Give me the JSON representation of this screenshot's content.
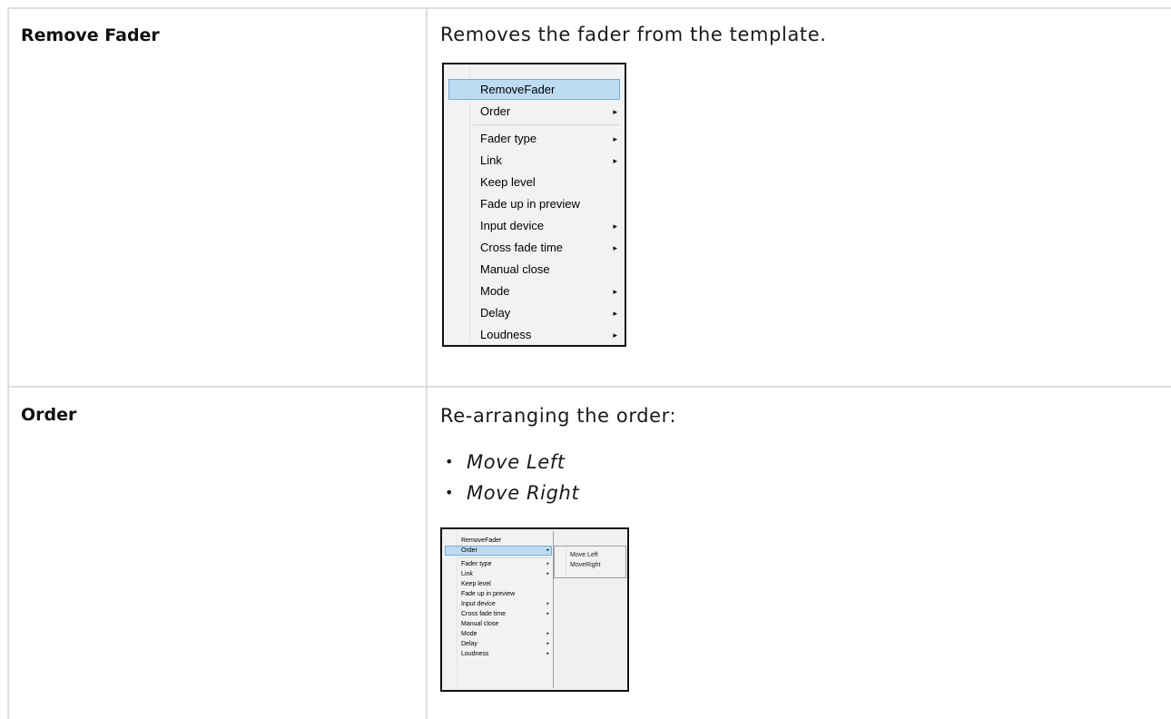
{
  "rows": [
    {
      "term": "Remove Fader",
      "description": "Removes the fader from the template."
    },
    {
      "term": "Order",
      "description": "Re-arranging the order:",
      "bullets": [
        "Move Left",
        "Move Right"
      ]
    }
  ],
  "menu": {
    "items": [
      {
        "label": "RemoveFader",
        "submenu": false
      },
      {
        "label": "Order",
        "submenu": true
      },
      {
        "label": "Fader type",
        "submenu": true
      },
      {
        "label": "Link",
        "submenu": true
      },
      {
        "label": "Keep level",
        "submenu": false
      },
      {
        "label": "Fade up in preview",
        "submenu": false
      },
      {
        "label": "Input device",
        "submenu": true
      },
      {
        "label": "Cross fade time",
        "submenu": true
      },
      {
        "label": "Manual close",
        "submenu": false
      },
      {
        "label": "Mode",
        "submenu": true
      },
      {
        "label": "Delay",
        "submenu": true
      },
      {
        "label": "Loudness",
        "submenu": true
      }
    ],
    "arrow": "▸",
    "highlight_color": "#bcdcf4"
  },
  "order_submenu": {
    "items": [
      "Move Left",
      "MoveRight"
    ]
  },
  "bullet_glyph": "•"
}
